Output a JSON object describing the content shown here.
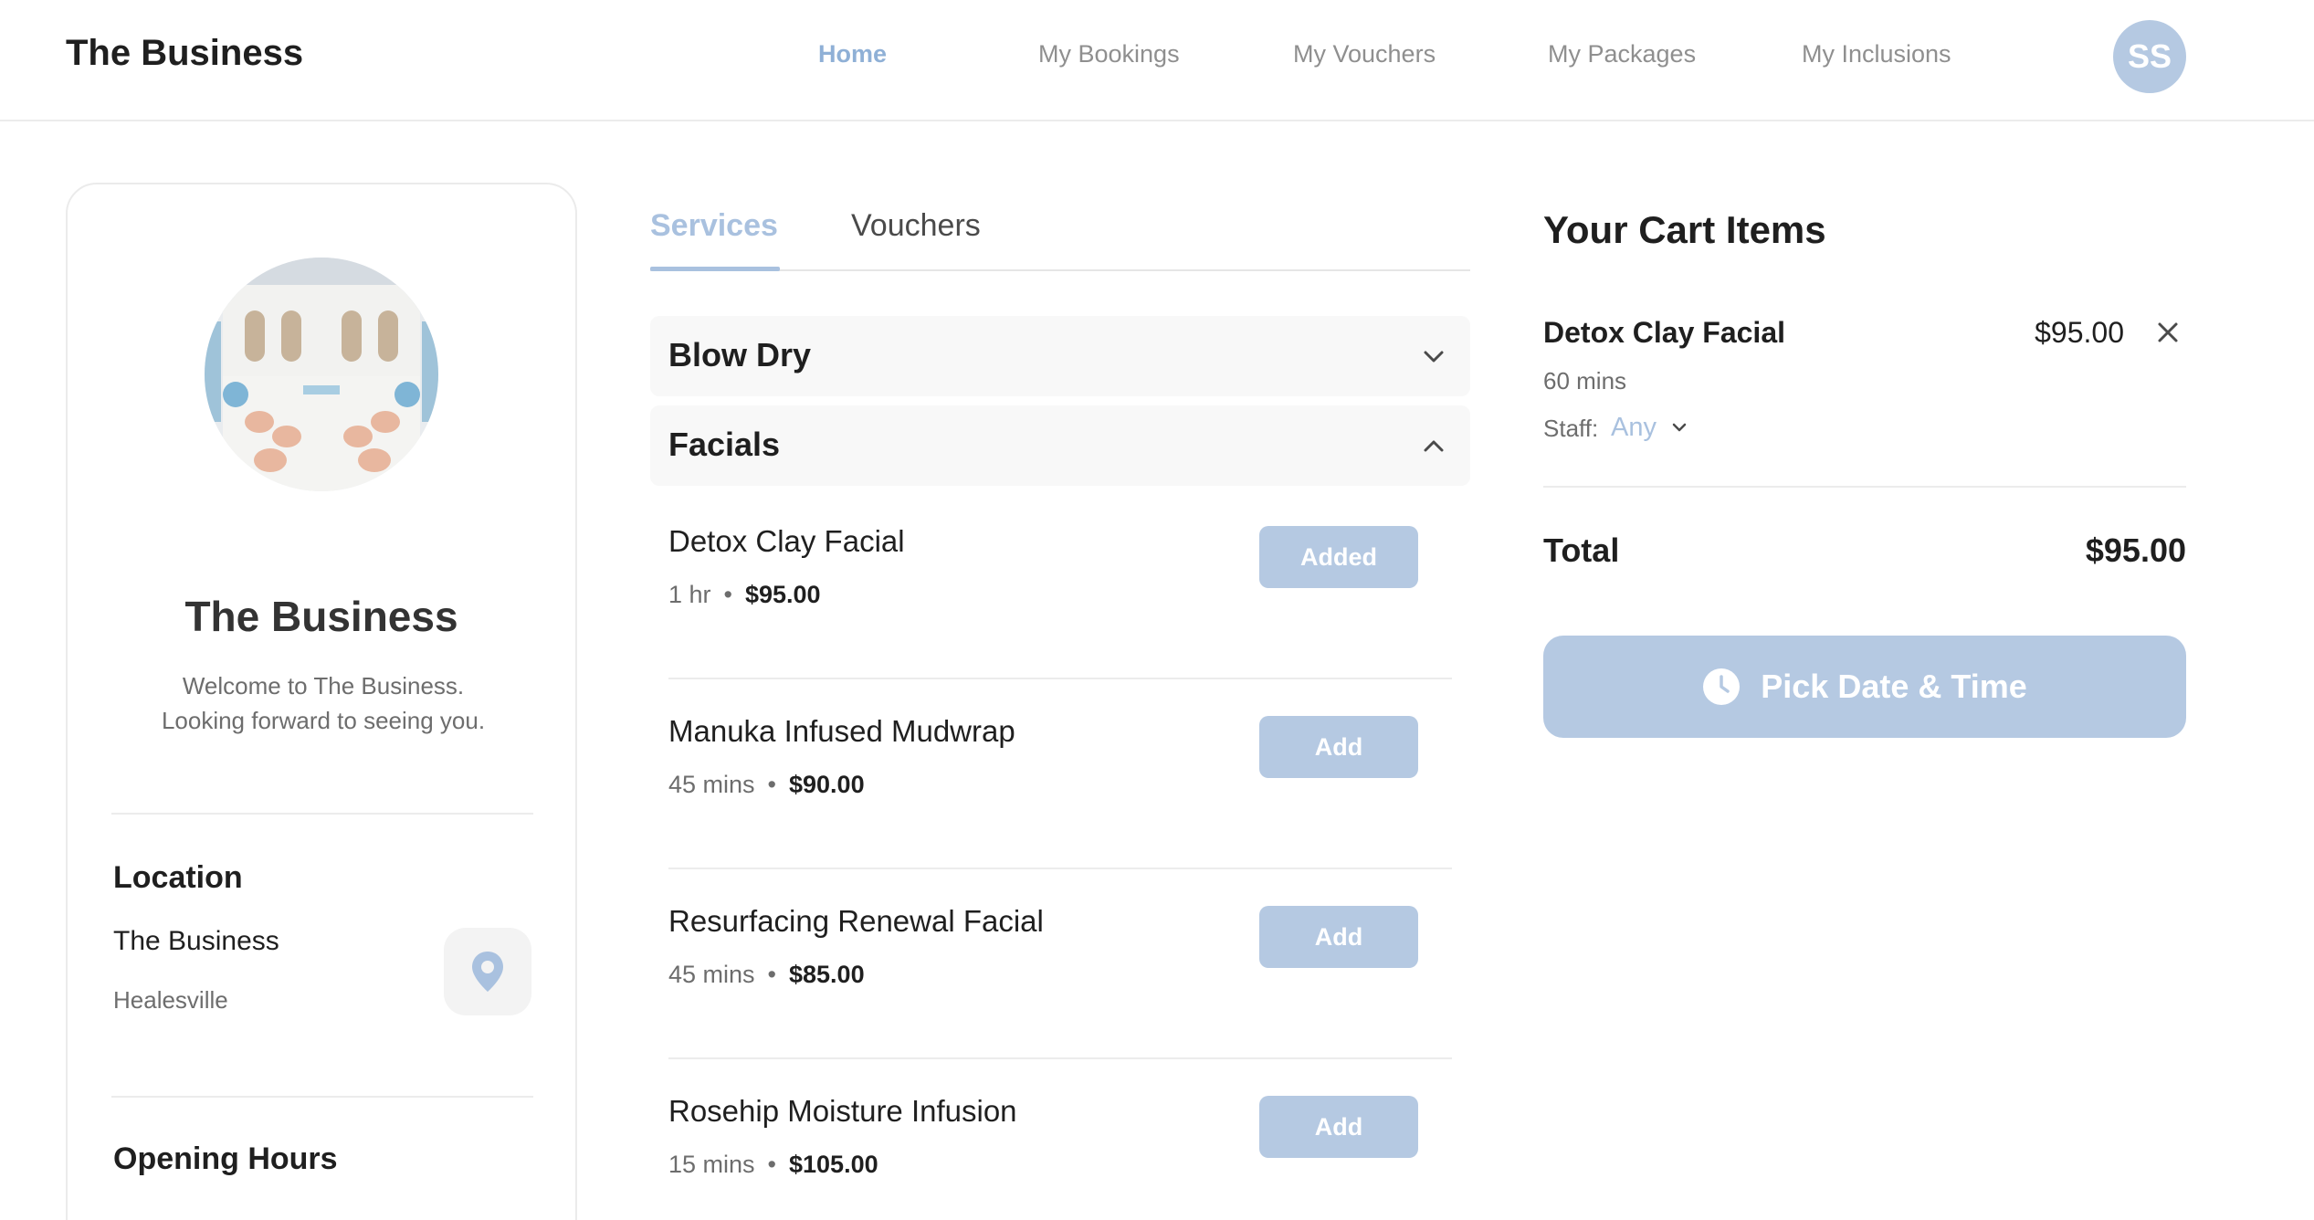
{
  "header": {
    "brand": "The Business",
    "nav": [
      {
        "label": "Home",
        "active": true
      },
      {
        "label": "My Bookings",
        "active": false
      },
      {
        "label": "My Vouchers",
        "active": false
      },
      {
        "label": "My Packages",
        "active": false
      },
      {
        "label": "My Inclusions",
        "active": false
      }
    ],
    "avatar_initials": "SS"
  },
  "profile": {
    "name": "The Business",
    "welcome": "Welcome to The Business. Looking forward to seeing you.",
    "location_title": "Location",
    "location_name": "The Business",
    "location_city": "Healesville",
    "hours_title": "Opening Hours",
    "pin_icon": "map-pin-icon"
  },
  "tabs": [
    {
      "label": "Services",
      "active": true
    },
    {
      "label": "Vouchers",
      "active": false
    }
  ],
  "categories": [
    {
      "label": "Blow Dry",
      "expanded": false
    },
    {
      "label": "Facials",
      "expanded": true
    }
  ],
  "services": [
    {
      "name": "Detox Clay Facial",
      "duration": "1 hr",
      "price": "$95.00",
      "button": "Added"
    },
    {
      "name": "Manuka Infused Mudwrap",
      "duration": "45 mins",
      "price": "$90.00",
      "button": "Add"
    },
    {
      "name": "Resurfacing Renewal Facial",
      "duration": "45 mins",
      "price": "$85.00",
      "button": "Add"
    },
    {
      "name": "Rosehip Moisture Infusion",
      "duration": "15 mins",
      "price": "$105.00",
      "button": "Add"
    }
  ],
  "cart": {
    "title": "Your Cart Items",
    "item_name": "Detox Clay Facial",
    "item_price": "$95.00",
    "item_duration": "60 mins",
    "staff_label": "Staff:",
    "staff_value": "Any",
    "total_label": "Total",
    "total_value": "$95.00",
    "pick_button": "Pick Date & Time"
  },
  "colors": {
    "accent": "#a9c1df",
    "button": "#b5c9e2",
    "text": "#1f1f1f",
    "muted": "#6d6d6d"
  }
}
